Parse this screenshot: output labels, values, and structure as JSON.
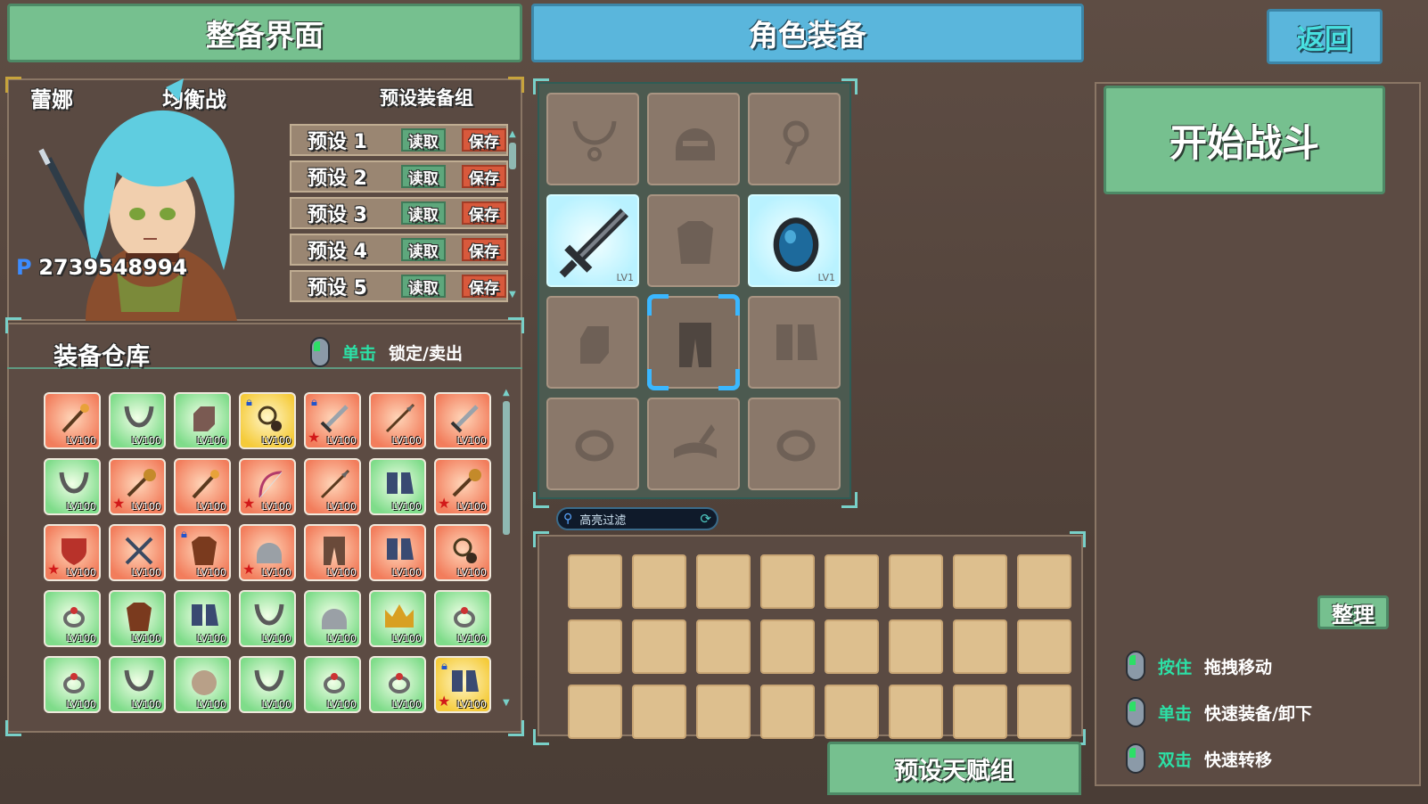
{
  "header": {
    "loadout_title": "整备界面",
    "character_equipment_title": "角色装备",
    "back_label": "返回"
  },
  "character": {
    "name": "蕾娜",
    "style": "均衡战",
    "points_prefix": "P",
    "points": "2739548994"
  },
  "presets": {
    "title": "预设装备组",
    "read_label": "读取",
    "save_label": "保存",
    "items": [
      "预设 1",
      "预设 2",
      "预设 3",
      "预设 4",
      "预设 5"
    ]
  },
  "warehouse": {
    "title": "装备仓库",
    "hint_key": "单击",
    "hint_action": "锁定/卖出",
    "items": [
      {
        "icon": "staff-icon",
        "rarity": "orange",
        "level": "LV100",
        "star": false,
        "locked": false
      },
      {
        "icon": "necklace-icon",
        "rarity": "green",
        "level": "LV100",
        "star": false,
        "locked": false
      },
      {
        "icon": "gauntlet-icon",
        "rarity": "green",
        "level": "LV100",
        "star": false,
        "locked": false
      },
      {
        "icon": "amulet-icon",
        "rarity": "yellow",
        "level": "LV100",
        "star": false,
        "locked": true
      },
      {
        "icon": "sword-icon",
        "rarity": "orange",
        "level": "LV100",
        "star": true,
        "locked": true
      },
      {
        "icon": "spear-icon",
        "rarity": "orange",
        "level": "LV100",
        "star": false,
        "locked": false
      },
      {
        "icon": "sword-icon",
        "rarity": "orange",
        "level": "LV100",
        "star": false,
        "locked": false
      },
      {
        "icon": "necklace-icon",
        "rarity": "green",
        "level": "LV100",
        "star": false,
        "locked": false
      },
      {
        "icon": "mace-icon",
        "rarity": "orange",
        "level": "LV100",
        "star": true,
        "locked": false
      },
      {
        "icon": "staff-icon",
        "rarity": "orange",
        "level": "LV100",
        "star": false,
        "locked": false
      },
      {
        "icon": "bow-icon",
        "rarity": "orange",
        "level": "LV100",
        "star": true,
        "locked": false
      },
      {
        "icon": "spear-icon",
        "rarity": "orange",
        "level": "LV100",
        "star": false,
        "locked": false
      },
      {
        "icon": "boots-icon",
        "rarity": "green",
        "level": "LV100",
        "star": false,
        "locked": false
      },
      {
        "icon": "mace-icon",
        "rarity": "orange",
        "level": "LV100",
        "star": true,
        "locked": false
      },
      {
        "icon": "shield-icon",
        "rarity": "orange",
        "level": "LV100",
        "star": true,
        "locked": false
      },
      {
        "icon": "crossed-swords-icon",
        "rarity": "orange",
        "level": "LV100",
        "star": false,
        "locked": false
      },
      {
        "icon": "armor-icon",
        "rarity": "orange",
        "level": "LV100",
        "star": false,
        "locked": true
      },
      {
        "icon": "helmet-icon",
        "rarity": "orange",
        "level": "LV100",
        "star": true,
        "locked": false
      },
      {
        "icon": "leggings-icon",
        "rarity": "orange",
        "level": "LV100",
        "star": false,
        "locked": false
      },
      {
        "icon": "boots-icon",
        "rarity": "orange",
        "level": "LV100",
        "star": false,
        "locked": false
      },
      {
        "icon": "amulet-icon",
        "rarity": "orange",
        "level": "LV100",
        "star": false,
        "locked": false
      },
      {
        "icon": "ring-icon",
        "rarity": "green",
        "level": "LV100",
        "star": false,
        "locked": false
      },
      {
        "icon": "armor-icon",
        "rarity": "green",
        "level": "LV100",
        "star": false,
        "locked": false
      },
      {
        "icon": "boots-icon",
        "rarity": "green",
        "level": "LV100",
        "star": false,
        "locked": false
      },
      {
        "icon": "necklace-icon",
        "rarity": "green",
        "level": "LV100",
        "star": false,
        "locked": false
      },
      {
        "icon": "helmet-icon",
        "rarity": "green",
        "level": "LV100",
        "star": false,
        "locked": false
      },
      {
        "icon": "crown-icon",
        "rarity": "green",
        "level": "LV100",
        "star": false,
        "locked": false
      },
      {
        "icon": "ring-icon",
        "rarity": "green",
        "level": "LV100",
        "star": false,
        "locked": false
      },
      {
        "icon": "ring-icon",
        "rarity": "green",
        "level": "LV100",
        "star": false,
        "locked": false
      },
      {
        "icon": "necklace-icon",
        "rarity": "green",
        "level": "LV100",
        "star": false,
        "locked": false
      },
      {
        "icon": "orb-icon",
        "rarity": "green",
        "level": "LV100",
        "star": false,
        "locked": false
      },
      {
        "icon": "necklace-icon",
        "rarity": "green",
        "level": "LV100",
        "star": false,
        "locked": false
      },
      {
        "icon": "ring-icon",
        "rarity": "green",
        "level": "LV100",
        "star": false,
        "locked": false
      },
      {
        "icon": "ring-icon",
        "rarity": "green",
        "level": "LV100",
        "star": false,
        "locked": false
      },
      {
        "icon": "boots-icon",
        "rarity": "yellow",
        "level": "LV100",
        "star": true,
        "locked": true
      }
    ]
  },
  "equipment_slots": {
    "weapon_level": "LV1",
    "offhand_level": "LV1"
  },
  "filter": {
    "placeholder": "高亮过滤"
  },
  "talent_preset_label": "预设天赋组",
  "start_battle_label": "开始战斗",
  "sort_label": "整理",
  "help": [
    {
      "key": "按住",
      "action": "拖拽移动"
    },
    {
      "key": "单击",
      "action": "快速装备/卸下"
    },
    {
      "key": "双击",
      "action": "快速转移"
    }
  ],
  "colors": {
    "header_green": "#76c08f",
    "header_blue": "#5ab6dc",
    "read_button": "#5ea77c",
    "save_button": "#d8593c",
    "help_key": "#2ce0a6",
    "equipped_slot": "#b9f2ff",
    "bag_slot": "#ddbf8e"
  }
}
